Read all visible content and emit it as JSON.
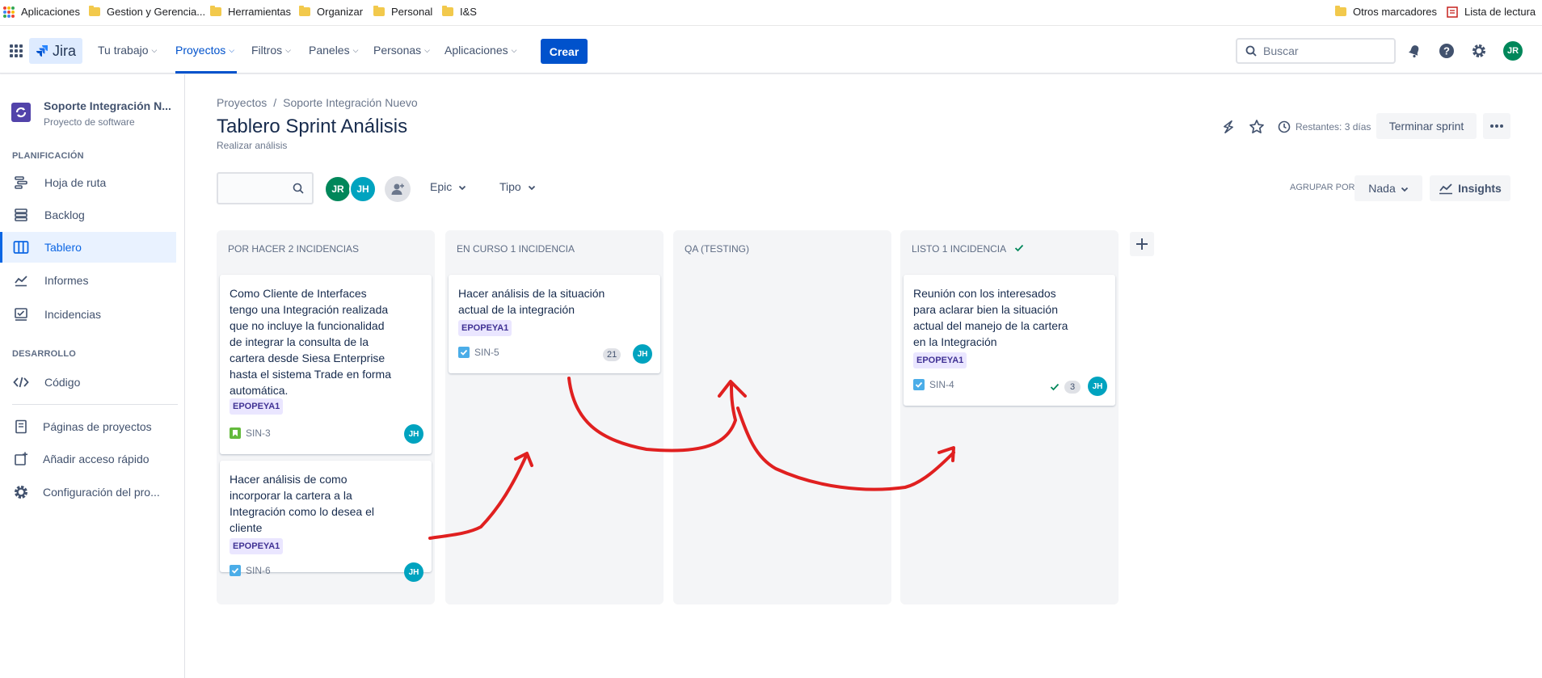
{
  "bookmarks": {
    "apps": "Aplicaciones",
    "folders": [
      "Gestion y Gerencia...",
      "Herramientas",
      "Organizar",
      "Personal",
      "I&S"
    ],
    "other": "Otros marcadores",
    "reading_list": "Lista de lectura"
  },
  "nav": {
    "logo": "Jira",
    "items": [
      "Tu trabajo",
      "Proyectos",
      "Filtros",
      "Paneles",
      "Personas",
      "Aplicaciones"
    ],
    "create": "Crear",
    "search_placeholder": "Buscar",
    "user_initials": "JR"
  },
  "sidebar": {
    "project_name": "Soporte Integración N...",
    "project_type": "Proyecto de software",
    "planning_title": "PLANIFICACIÓN",
    "planning_items": [
      "Hoja de ruta",
      "Backlog",
      "Tablero",
      "Informes",
      "Incidencias"
    ],
    "dev_title": "DESARROLLO",
    "dev_items": [
      "Código"
    ],
    "extra_items": [
      "Páginas de proyectos",
      "Añadir acceso rápido",
      "Configuración del pro..."
    ]
  },
  "header": {
    "breadcrumb": [
      "Proyectos",
      "Soporte Integración Nuevo"
    ],
    "title": "Tablero Sprint Análisis",
    "subtitle": "Realizar análisis",
    "remaining": "Restantes: 3 días",
    "end_sprint": "Terminar sprint"
  },
  "toolbar": {
    "avatars": [
      "JR",
      "JH"
    ],
    "epic": "Epic",
    "tipo": "Tipo",
    "group_by_label": "AGRUPAR POR",
    "group_by_value": "Nada",
    "insights": "Insights"
  },
  "columns": [
    {
      "title": "POR HACER 2 INCIDENCIAS",
      "cards": [
        {
          "lines": [
            "Como Cliente de Interfaces",
            "tengo una Integración realizada",
            "que no incluye la funcionalidad",
            "de integrar la consulta de la",
            "cartera desde Siesa Enterprise",
            "hasta el sistema Trade en forma",
            "automática."
          ],
          "epic": "EPOPEYA1",
          "key": "SIN-3",
          "type": "story",
          "assignee": "JH"
        },
        {
          "lines": [
            "Hacer análisis de como",
            "incorporar la cartera a la",
            "Integración como lo desea el",
            "cliente"
          ],
          "epic": "EPOPEYA1",
          "key": "SIN-6",
          "type": "task",
          "assignee": "JH"
        }
      ]
    },
    {
      "title": "EN CURSO 1 INCIDENCIA",
      "cards": [
        {
          "lines": [
            "Hacer análisis de la situación",
            "actual de la integración"
          ],
          "epic": "EPOPEYA1",
          "key": "SIN-5",
          "type": "task",
          "estimate": "21",
          "assignee": "JH"
        }
      ]
    },
    {
      "title": "QA (TESTING)",
      "cards": []
    },
    {
      "title": "LISTO 1 INCIDENCIA",
      "cards": [
        {
          "lines": [
            "Reunión con los interesados",
            "para aclarar bien la situación",
            "actual del manejo de la cartera",
            "en la Integración"
          ],
          "epic": "EPOPEYA1",
          "key": "SIN-4",
          "type": "task",
          "estimate": "3",
          "assignee": "JH"
        }
      ]
    }
  ],
  "colors": {
    "primary": "#0052cc",
    "annotation": "#e02020",
    "avatar_jr": "#00875a",
    "avatar_jh": "#00a3bf"
  }
}
